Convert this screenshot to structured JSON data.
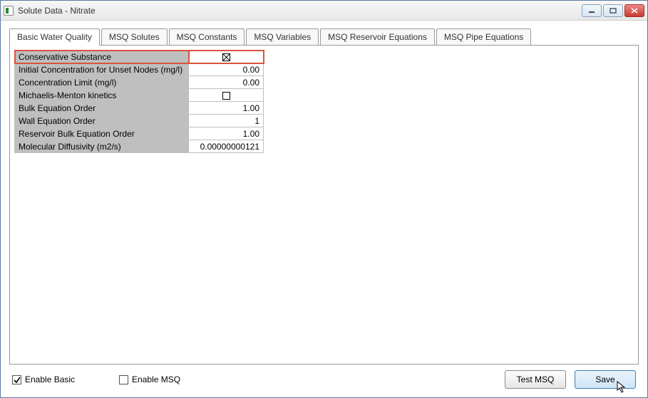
{
  "window": {
    "title": "Solute Data - Nitrate"
  },
  "tabs": [
    {
      "label": "Basic Water Quality"
    },
    {
      "label": "MSQ Solutes"
    },
    {
      "label": "MSQ Constants"
    },
    {
      "label": "MSQ Variables"
    },
    {
      "label": "MSQ Reservoir Equations"
    },
    {
      "label": "MSQ Pipe Equations"
    }
  ],
  "activeTab": 0,
  "properties": [
    {
      "label": "Conservative Substance",
      "type": "checkbox",
      "checked": true,
      "selected": true
    },
    {
      "label": "Initial Concentration for Unset Nodes (mg/l)",
      "type": "number",
      "value": "0.00"
    },
    {
      "label": "Concentration Limit (mg/l)",
      "type": "number",
      "value": "0.00"
    },
    {
      "label": "Michaelis-Menton kinetics",
      "type": "checkbox",
      "checked": false
    },
    {
      "label": "Bulk Equation Order",
      "type": "number",
      "value": "1.00"
    },
    {
      "label": "Wall Equation Order",
      "type": "number",
      "value": "1"
    },
    {
      "label": "Reservoir Bulk Equation Order",
      "type": "number",
      "value": "1.00"
    },
    {
      "label": "Molecular Diffusivity (m2/s)",
      "type": "number",
      "value": "0.00000000121"
    }
  ],
  "bottom": {
    "enableBasic": {
      "label": "Enable Basic",
      "checked": true
    },
    "enableMSQ": {
      "label": "Enable MSQ",
      "checked": false
    },
    "testMSQ": "Test MSQ",
    "save": "Save"
  }
}
